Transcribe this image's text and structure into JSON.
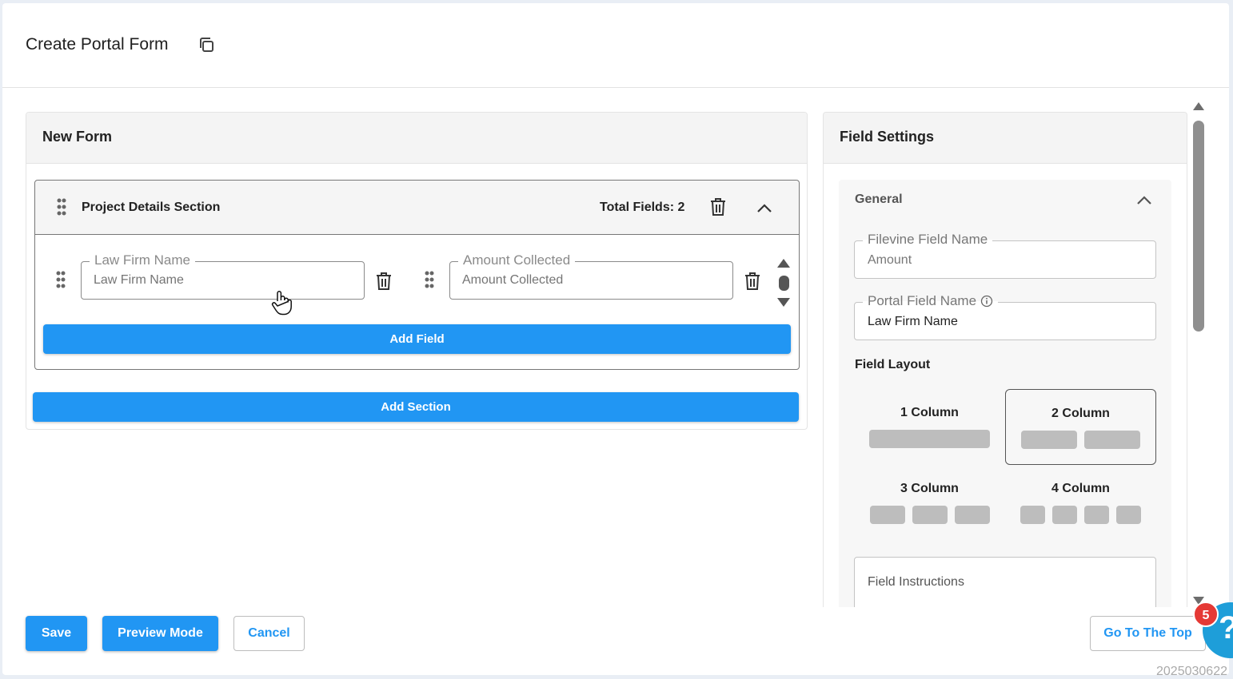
{
  "header": {
    "title": "Create Portal Form",
    "copy_icon": "copy-icon"
  },
  "form_panel": {
    "title": "New Form",
    "section": {
      "title": "Project Details Section",
      "total_fields": "Total Fields: 2",
      "fields": [
        {
          "label": "Law Firm Name",
          "placeholder": "Law Firm Name"
        },
        {
          "label": "Amount Collected",
          "placeholder": "Amount Collected"
        }
      ],
      "add_field_label": "Add Field"
    },
    "add_section_label": "Add Section"
  },
  "settings_panel": {
    "title": "Field Settings",
    "general": {
      "title": "General",
      "filevine_field": {
        "label": "Filevine Field Name",
        "value": "Amount"
      },
      "portal_field": {
        "label": "Portal Field Name",
        "value": "Law Firm Name",
        "info_icon": "info-icon"
      },
      "layout_label": "Field Layout",
      "layouts": [
        {
          "name": "1 Column",
          "bars": 1,
          "selected": false
        },
        {
          "name": "2 Column",
          "bars": 2,
          "selected": true
        },
        {
          "name": "3 Column",
          "bars": 3,
          "selected": false
        },
        {
          "name": "4 Column",
          "bars": 4,
          "selected": false
        }
      ],
      "instructions_placeholder": "Field Instructions"
    }
  },
  "footer": {
    "save_label": "Save",
    "preview_label": "Preview Mode",
    "cancel_label": "Cancel",
    "go_top_label": "Go To The Top"
  },
  "help": {
    "badge_count": "5",
    "glyph": "?"
  },
  "build_stamp": "2025030622",
  "colors": {
    "accent": "#2196f3",
    "badge": "#e53935",
    "help": "#1e9ed9"
  }
}
